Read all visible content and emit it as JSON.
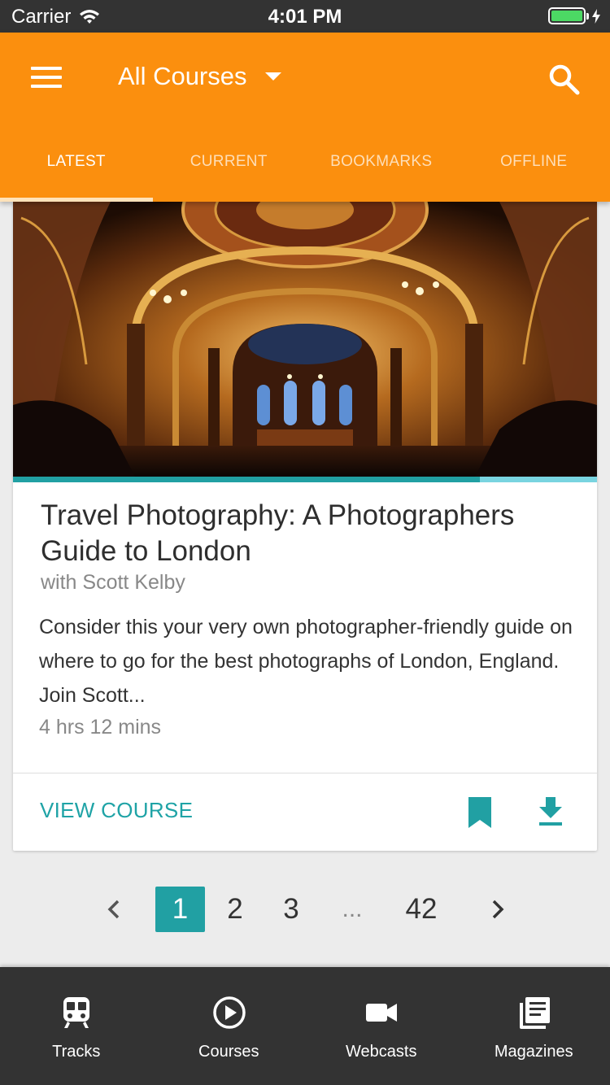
{
  "status_bar": {
    "carrier": "Carrier",
    "time": "4:01 PM",
    "battery_level": 1.0,
    "wifi_icon": "wifi-icon",
    "battery_color": "#4cd964"
  },
  "header": {
    "title": "All Courses",
    "background_color": "#fb8f0e",
    "menu_icon": "hamburger-menu-icon",
    "dropdown_icon": "caret-down-icon",
    "search_icon": "search-icon"
  },
  "tabs": [
    {
      "label": "LATEST",
      "active": true
    },
    {
      "label": "CURRENT",
      "active": false
    },
    {
      "label": "BOOKMARKS",
      "active": false
    },
    {
      "label": "OFFLINE",
      "active": false
    }
  ],
  "course": {
    "title": "Travel Photography: A Photographers Guide to London",
    "author": "with Scott Kelby",
    "description": "Consider this your very own photographer-friendly guide on where to go for the best photographs of London, England. Join Scott...",
    "duration": "4 hrs 12 mins",
    "progress": 0.8,
    "view_label": "VIEW COURSE",
    "accent_color": "#21a0a3",
    "bookmark_icon": "bookmark-icon",
    "download_icon": "download-icon"
  },
  "pagination": {
    "prev_icon": "chevron-left-icon",
    "pages": [
      "1",
      "2",
      "3"
    ],
    "ellipsis": "...",
    "last_page": "42",
    "current": "1",
    "next_icon": "chevron-right-icon"
  },
  "bottom_nav": [
    {
      "label": "Tracks",
      "icon": "train-icon"
    },
    {
      "label": "Courses",
      "icon": "play-circle-icon"
    },
    {
      "label": "Webcasts",
      "icon": "video-camera-icon"
    },
    {
      "label": "Magazines",
      "icon": "magazine-icon"
    }
  ]
}
